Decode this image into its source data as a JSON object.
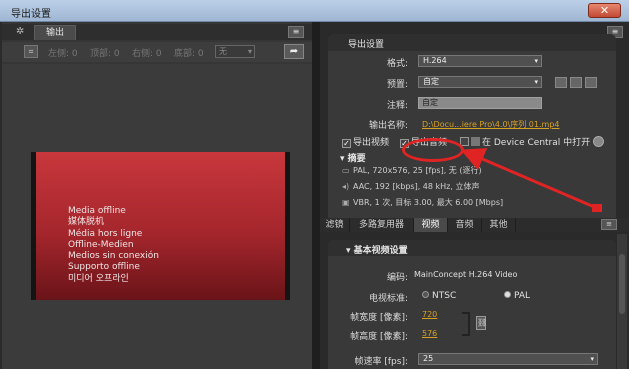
{
  "window": {
    "title": "导出设置",
    "close_label": "✕"
  },
  "source_panel": {
    "tab_label": "输出",
    "crop_fields": [
      {
        "label": "左侧:",
        "value": "0"
      },
      {
        "label": "顶部:",
        "value": "0"
      },
      {
        "label": "右侧:",
        "value": "0"
      },
      {
        "label": "底部:",
        "value": "0"
      }
    ],
    "ratio_value": "无",
    "offline_lines": [
      "Media offline",
      "媒体脱机",
      "Média hors ligne",
      "Offline-Medien",
      "Medios sin conexión",
      "Supporto offline",
      "미디어 오프라인"
    ],
    "frame_color": "#b52f35"
  },
  "export_settings": {
    "header": "导出设置",
    "format": {
      "label": "格式:",
      "value": "H.264"
    },
    "preset": {
      "label": "预置:",
      "value": "自定"
    },
    "notes": {
      "label": "注释:",
      "value": "自定"
    },
    "output_name": {
      "label": "输出名称:",
      "value": "D:\\Docu...iere Pro\\4.0\\序列 01.mp4"
    },
    "export_video": {
      "label": "导出视频",
      "checked": true
    },
    "export_audio": {
      "label": "导出音频",
      "checked": true
    },
    "device_central": {
      "label": "在 Device Central 中打开",
      "checked": false
    },
    "summary": {
      "header": "摘要",
      "video_line": "PAL, 720x576, 25 [fps], 无 (逐行)",
      "audio_line": "AAC, 192 [kbps], 48 kHz, 立体声",
      "bitrate_line": "VBR, 1 次, 目标 3.00, 最大 6.00 [Mbps]"
    },
    "highlight_color": "#e02424"
  },
  "settings_tabs": {
    "tabs": [
      "滤镜",
      "多路复用器",
      "视频",
      "音频",
      "其他"
    ],
    "active_index": 2
  },
  "video_settings": {
    "header": "基本视频设置",
    "codec": {
      "label": "编码:",
      "value": "MainConcept H.264 Video"
    },
    "tv_standard": {
      "label": "电视标准:",
      "options": [
        "NTSC",
        "PAL"
      ],
      "selected": "PAL"
    },
    "frame_width": {
      "label": "帧宽度 [像素]:",
      "value": "720"
    },
    "frame_height": {
      "label": "帧高度 [像素]:",
      "value": "576"
    },
    "frame_rate": {
      "label": "帧速率 [fps]:",
      "value": "25"
    }
  }
}
